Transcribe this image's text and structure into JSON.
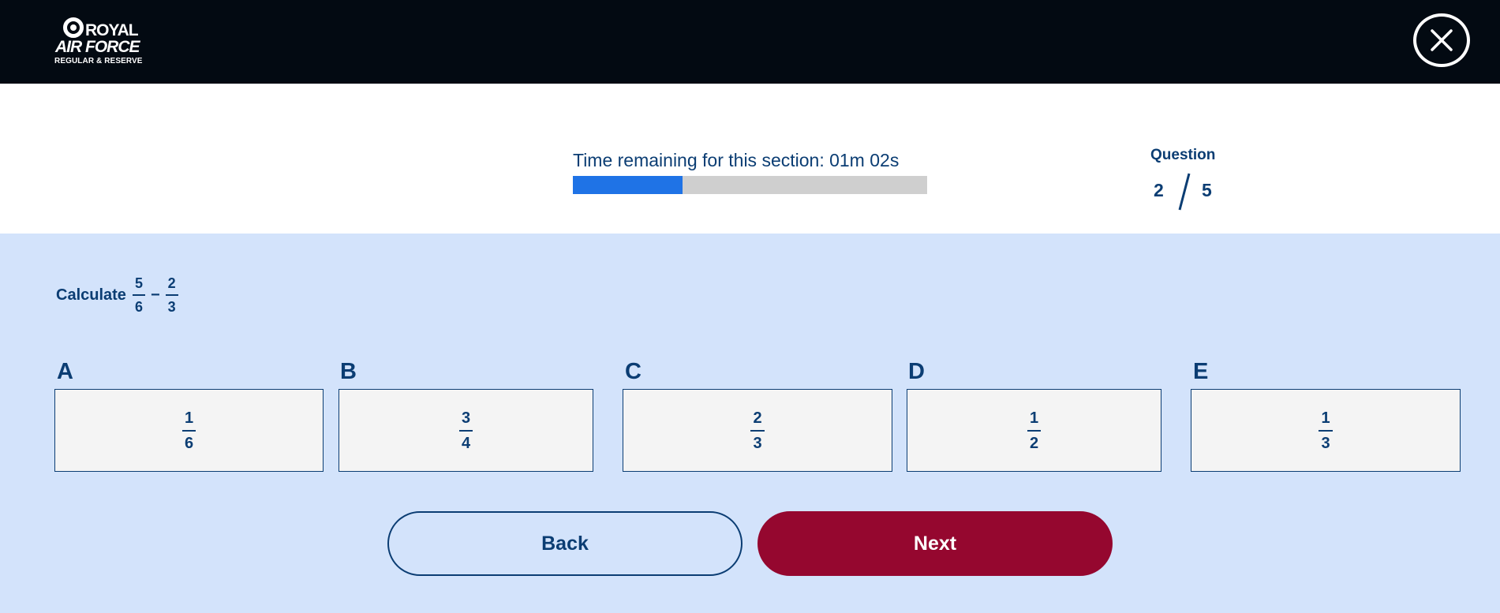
{
  "header": {
    "logo": {
      "line1": "ROYAL",
      "line2": "AIR FORCE",
      "line3": "REGULAR & RESERVE"
    },
    "close_icon": "close-icon"
  },
  "status": {
    "timer_text": "Time remaining for this section: 01m 02s",
    "timer_progress_fraction": 0.31,
    "colors": {
      "progress_fill": "#1f73e6",
      "progress_track": "#cfcfcf"
    },
    "question_label": "Question",
    "question_current": "2",
    "question_total": "5"
  },
  "question": {
    "lead": "Calculate",
    "operand1": {
      "num": "5",
      "den": "6"
    },
    "operator": "−",
    "operand2": {
      "num": "2",
      "den": "3"
    }
  },
  "options": [
    {
      "letter": "A",
      "num": "1",
      "den": "6"
    },
    {
      "letter": "B",
      "num": "3",
      "den": "4"
    },
    {
      "letter": "C",
      "num": "2",
      "den": "3"
    },
    {
      "letter": "D",
      "num": "1",
      "den": "2"
    },
    {
      "letter": "E",
      "num": "1",
      "den": "3"
    }
  ],
  "nav": {
    "back_label": "Back",
    "next_label": "Next",
    "colors": {
      "next_bg": "#95072f",
      "text": "#0b3d73",
      "page_bg": "#d3e3fb"
    }
  }
}
